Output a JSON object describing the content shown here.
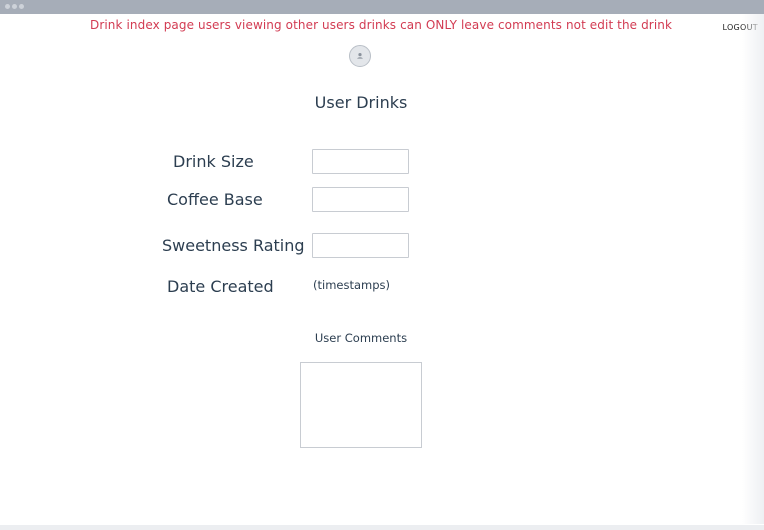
{
  "header": {
    "note": "Drink index page users viewing other users drinks can ONLY leave comments not edit the drink",
    "logout_label": "LOGOUT",
    "avatar_icon": "user-icon"
  },
  "main": {
    "title": "User Drinks",
    "fields": {
      "drink_size_label": "Drink Size",
      "drink_size_value": "",
      "coffee_base_label": "Coffee Base",
      "coffee_base_value": "",
      "sweetness_label": "Sweetness Rating",
      "sweetness_value": "",
      "date_created_label": "Date Created",
      "date_created_value": "(timestamps)"
    },
    "comments_label": "User Comments",
    "comments_value": ""
  },
  "colors": {
    "note": "#d23b52",
    "text": "#2c3e50",
    "titlebar": "#a6adb8"
  }
}
